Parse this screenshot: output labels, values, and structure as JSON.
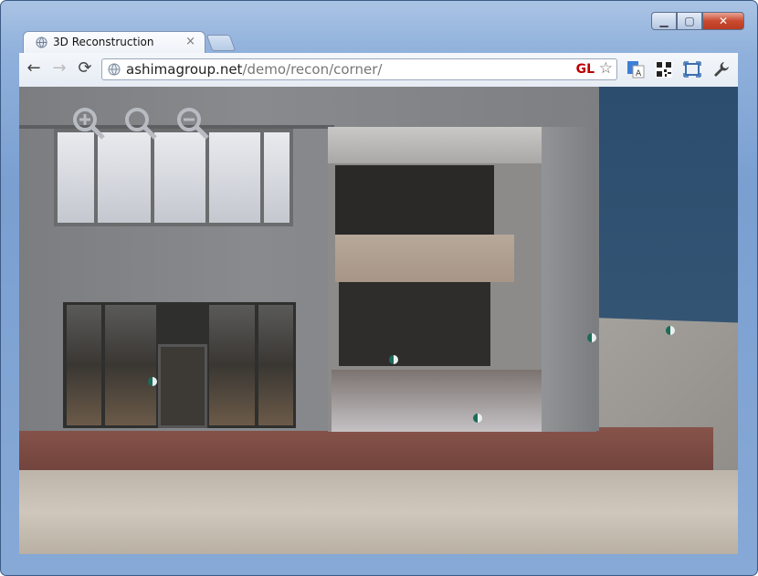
{
  "window": {
    "tab_title": "3D Reconstruction",
    "tab_close": "×",
    "minimize_glyph": "▁",
    "maximize_glyph": "▢",
    "close_glyph": "✕"
  },
  "toolbar": {
    "back_glyph": "←",
    "forward_glyph": "→",
    "reload_glyph": "⟳",
    "url_host": "ashimagroup.net",
    "url_path": "/demo/recon/corner/",
    "gl_badge": "GL",
    "star_glyph": "☆",
    "extensions": [
      "translate-icon",
      "qr-code-icon",
      "fullscreen-icon",
      "wrench-icon"
    ]
  },
  "viewer": {
    "zoom_controls": [
      "zoom-in-icon",
      "zoom-reset-icon",
      "zoom-out-icon"
    ],
    "scene": "3D reconstruction of building corner"
  }
}
